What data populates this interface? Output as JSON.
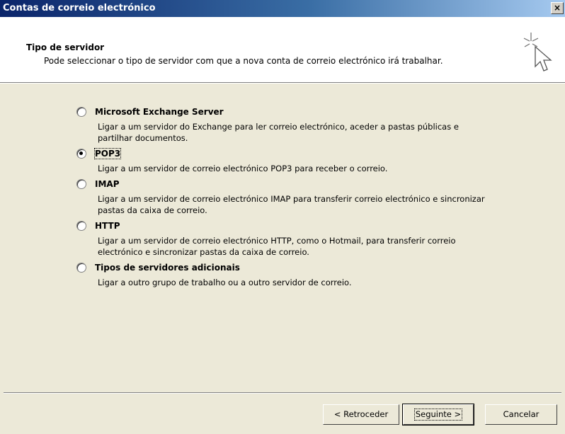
{
  "window": {
    "title": "Contas de correio electrónico",
    "close_glyph": "×"
  },
  "header": {
    "title": "Tipo de servidor",
    "description": "Pode seleccionar o tipo de servidor com que a nova conta de correio electrónico irá trabalhar.",
    "icon": "wizard-cursor-sparkle-icon"
  },
  "options": [
    {
      "label": "Microsoft Exchange Server",
      "selected": false,
      "description": "Ligar a um servidor do Exchange para ler correio electrónico, aceder a pastas públicas e partilhar documentos."
    },
    {
      "label": "POP3",
      "selected": true,
      "description": "Ligar a um servidor de correio electrónico POP3 para receber o correio."
    },
    {
      "label": "IMAP",
      "selected": false,
      "description": "Ligar a um servidor de correio electrónico IMAP para transferir correio electrónico e sincronizar pastas da caixa de correio."
    },
    {
      "label": "HTTP",
      "selected": false,
      "description": "Ligar a um servidor de correio electrónico HTTP, como o Hotmail, para transferir correio electrónico e sincronizar pastas da caixa de correio."
    },
    {
      "label": "Tipos de servidores adicionais",
      "selected": false,
      "description": "Ligar a outro grupo de trabalho ou a outro servidor de correio."
    }
  ],
  "buttons": {
    "back": "< Retroceder",
    "next": "Seguinte >",
    "cancel": "Cancelar"
  }
}
